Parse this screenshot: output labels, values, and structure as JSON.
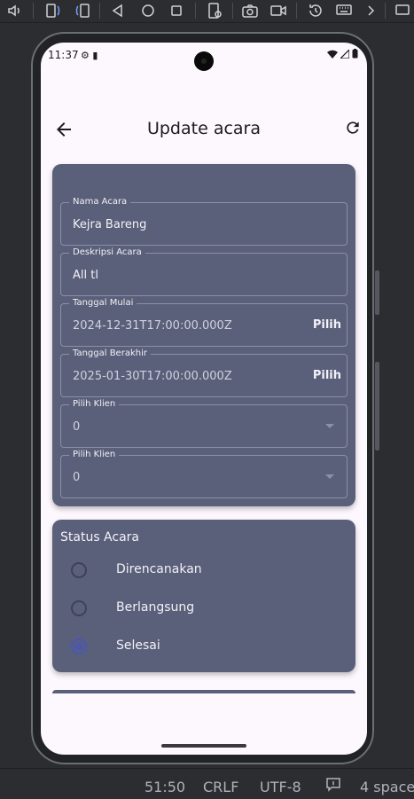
{
  "ide": {
    "status": {
      "position": "51:50",
      "line_ending": "CRLF",
      "encoding": "UTF-8",
      "indent": "4 space"
    }
  },
  "device": {
    "time": "11:37"
  },
  "app": {
    "title": "Update acara",
    "form": {
      "fields": [
        {
          "label": "Nama Acara",
          "value": "Kejra Bareng"
        },
        {
          "label": "Deskripsi Acara",
          "value": "All tl"
        },
        {
          "label": "Tanggal Mulai",
          "value": "2024-12-31T17:00:00.000Z",
          "action": "Pilih"
        },
        {
          "label": "Tanggal Berakhir",
          "value": "2025-01-30T17:00:00.000Z",
          "action": "Pilih"
        },
        {
          "label": "Pilih Klien",
          "value": "0"
        },
        {
          "label": "Pilih Klien",
          "value": "0"
        }
      ]
    },
    "status_section": {
      "title": "Status Acara",
      "options": [
        {
          "label": "Direncanakan",
          "selected": false
        },
        {
          "label": "Berlangsung",
          "selected": false
        },
        {
          "label": "Selesai",
          "selected": true
        }
      ]
    }
  },
  "colors": {
    "card": "#5a5f7a",
    "screen_bg": "#fdf7fe",
    "radio_selected": "#4a56b8"
  }
}
